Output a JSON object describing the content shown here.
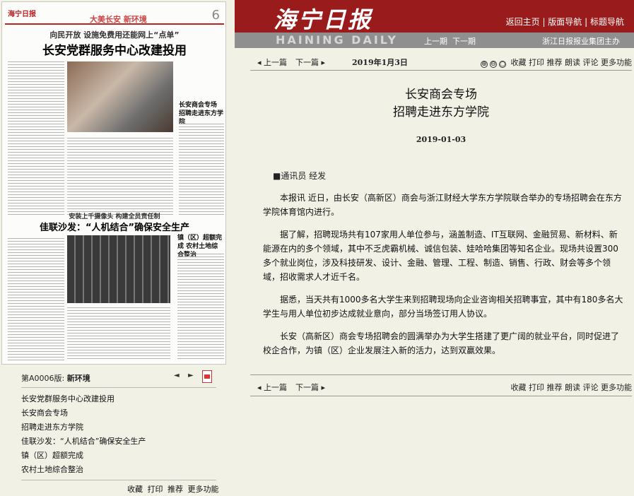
{
  "thumbnail": {
    "logo": "海宁日报",
    "section": "大美长安 新环境",
    "page_number": "6",
    "kicker": "向民开放 设施免费用还能网上“点单”",
    "headline1": "长安党群服务中心改建投用",
    "side_headline": "长安商会专场 招聘走进东方学院",
    "kicker2": "安装上千摄像头 构建全员责任制",
    "headline2": "佳联沙发：“人机结合”确保安全生产",
    "side_headline2": "镇（区）超额完成 农村土地综合整治"
  },
  "page_bar": {
    "page_label": "第A0006版:",
    "page_name": "新环境",
    "prev": "◄",
    "next": "►"
  },
  "titles": [
    "长安党群服务中心改建投用",
    "长安商会专场",
    "招聘走进东方学院",
    "佳联沙发：“人机结合”确保安全生产",
    "镇（区）超额完成",
    "农村土地综合整治"
  ],
  "left_tools": [
    "收藏",
    "打印",
    "推荐",
    "更多功能"
  ],
  "header": {
    "brand": "海宁日报",
    "brand_en": "HAINING DAILY",
    "nav": [
      "返回主页",
      "版面导航",
      "标题导航"
    ],
    "prev_issue": "上一期",
    "next_issue": "下一期",
    "group": "浙江日报报业集团主办"
  },
  "toolbar": {
    "prev_article": "上一篇",
    "next_article": "下一篇",
    "date": "2019年1月3日",
    "zoom": [
      "⊕",
      "⊖",
      "○"
    ],
    "tools": [
      "收藏",
      "打印",
      "推荐",
      "朗读",
      "评论",
      "更多功能"
    ]
  },
  "article": {
    "title_line1": "长安商会专场",
    "title_line2": "招聘走进东方学院",
    "date": "2019-01-03",
    "byline": "■通讯员 经发",
    "paragraphs": [
      "本报讯 近日，由长安（高新区）商会与浙江财经大学东方学院联合举办的专场招聘会在东方学院体育馆内进行。",
      "据了解，招聘现场共有107家用人单位参与，涵盖制造、IT互联网、金融贸易、新材料、新能源在内的多个领域，其中不乏虎霸机械、诚信包装、娃哈哈集团等知名企业。现场共设置300多个就业岗位，涉及科技研发、设计、金融、管理、工程、制造、销售、行政、财会等多个领域，招收需求人才近千名。",
      "据悉，当天共有1000多名大学生来到招聘现场向企业咨询相关招聘事宜，其中有180多名大学生与用人单位初步达成就业意向，部分当场签订用人协议。",
      "长安（高新区）商会专场招聘会的圆满举办为大学生搭建了更广阔的就业平台，同时促进了校企合作，为镇（区）企业发展注入新的活力，达到双赢效果。"
    ]
  },
  "colors": {
    "header_red": "#9a1b1b",
    "bar_gray": "#8f8f8f",
    "background": "#f1f1e6"
  }
}
